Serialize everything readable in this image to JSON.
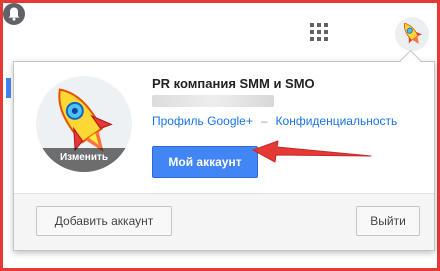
{
  "account": {
    "name": "PR компания SMM и SMO",
    "avatar_change_label": "Изменить"
  },
  "links": {
    "profile": "Профиль Google+",
    "separator": "–",
    "privacy": "Конфиденциальность"
  },
  "buttons": {
    "my_account": "Мой аккаунт",
    "add_account": "Добавить аккаунт",
    "sign_out": "Выйти"
  },
  "icons": {
    "topbar": [
      "apps-grid-icon",
      "notifications-bell-icon",
      "rocket-avatar-icon"
    ],
    "annotation": "red-arrow-icon"
  },
  "colors": {
    "frame_border": "#e53935",
    "primary_button": "#4285f4",
    "link": "#1a73e8",
    "annotation_arrow": "#e53935"
  }
}
